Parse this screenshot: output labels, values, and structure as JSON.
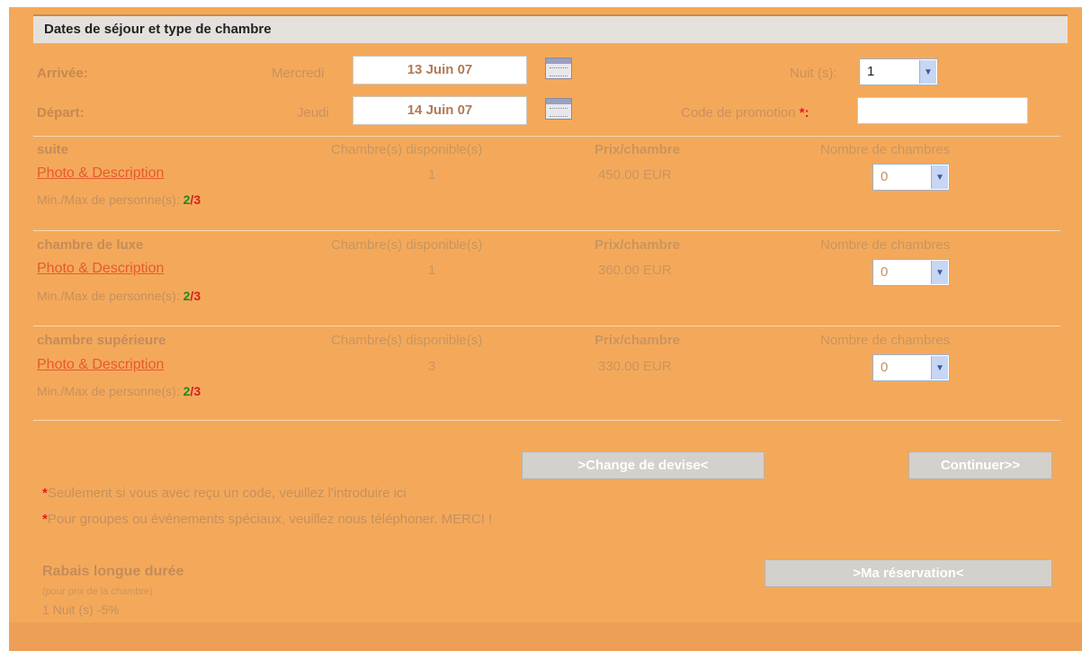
{
  "header": {
    "title": "Dates de séjour et type de chambre"
  },
  "stay": {
    "arrival_label": "Arrivée:",
    "arrival_day": "Mercredi",
    "arrival_date": "13 Juin 07",
    "departure_label": "Départ:",
    "departure_day": "Jeudi",
    "departure_date": "14 Juin 07",
    "nights_label": "Nuit (s):",
    "nights_value": "1",
    "promo_label": "Code de promotion",
    "promo_marker": "*:",
    "promo_value": ""
  },
  "columns": {
    "available": "Chambre(s) disponible(s)",
    "price": "Prix/chambre",
    "count": "Nombre de chambres"
  },
  "rooms": [
    {
      "name": "suite",
      "link": "Photo & Description",
      "available": "1",
      "price": "450.00 EUR",
      "count": "0",
      "minmax_label": "Min./Max de personne(s):",
      "min": "2",
      "slash": "/",
      "max": "3"
    },
    {
      "name": "chambre de luxe",
      "link": "Photo & Description",
      "available": "1",
      "price": "360.00 EUR",
      "count": "0",
      "minmax_label": "Min./Max de personne(s):",
      "min": "2",
      "slash": "/",
      "max": "3"
    },
    {
      "name": "chambre supérieure",
      "link": "Photo & Description",
      "available": "3",
      "price": "330.00 EUR",
      "count": "0",
      "minmax_label": "Min./Max de personne(s):",
      "min": "2",
      "slash": "/",
      "max": "3"
    }
  ],
  "buttons": {
    "currency": ">Change de devise<",
    "continue": "Continuer>>",
    "reservation": ">Ma réservation<"
  },
  "notes": {
    "star": "*",
    "promo_note": "Seulement si vous avec reçu un code, veuillez l'introduire ici",
    "group_note": "Pour groupes ou événements spéciaux, veuillez nous téléphoner. MERCI !"
  },
  "discount": {
    "title": "Rabais longue durée",
    "subtitle": "(pour prix de la chambre)",
    "line": "1 Nuit (s) -5%"
  },
  "icons": {
    "calendar": "calendar-icon",
    "dropdown": "chevron-down-icon"
  },
  "colors": {
    "panel": "#f4a95a",
    "link": "#e55a2e",
    "min": "#1e8a1e",
    "max": "#d42020"
  }
}
